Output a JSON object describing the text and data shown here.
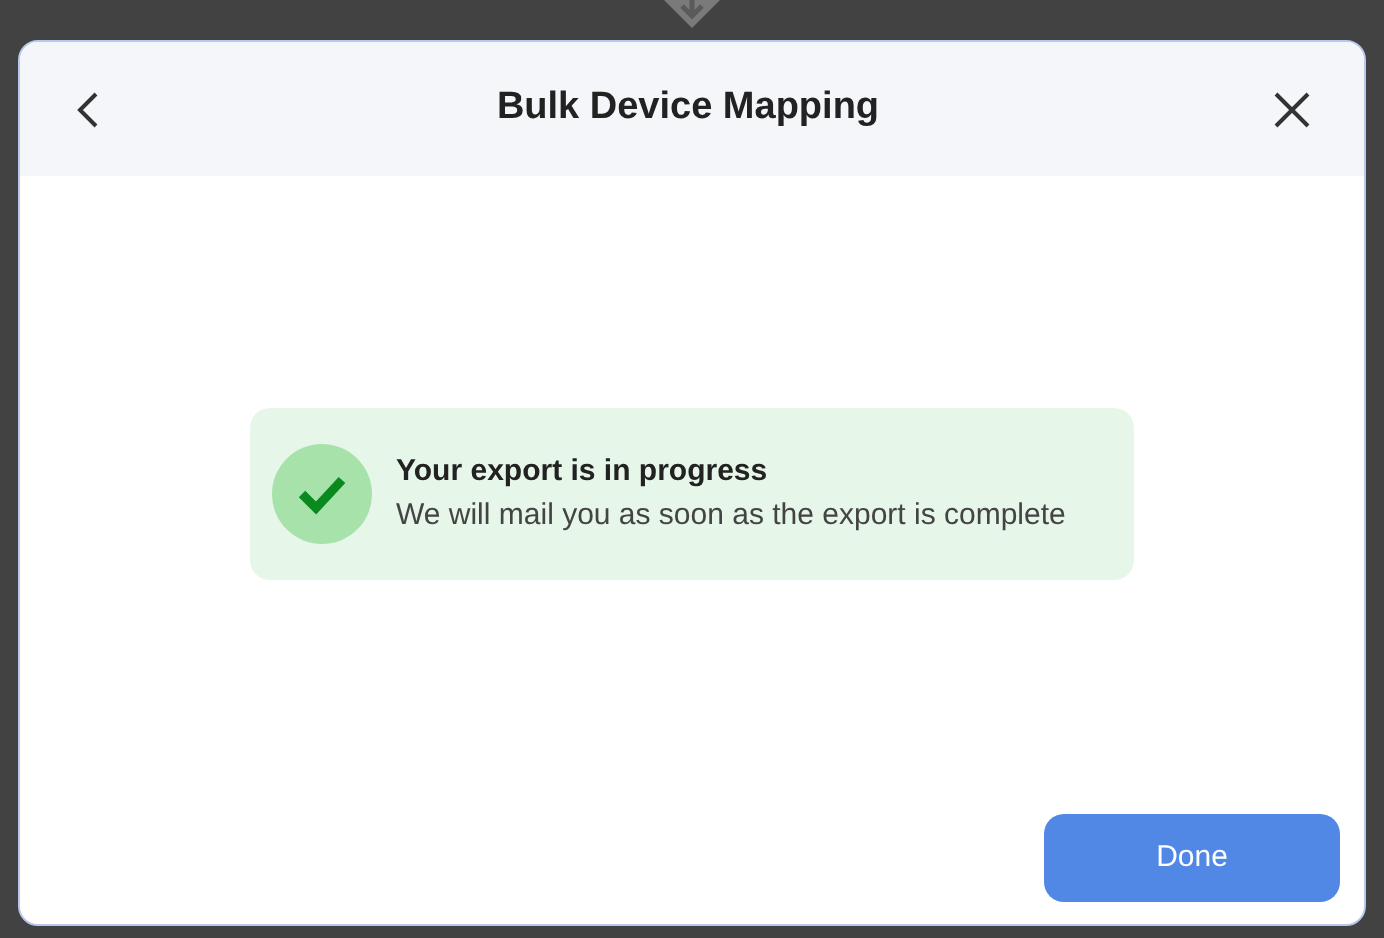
{
  "dialog": {
    "title": "Bulk Device Mapping"
  },
  "alert": {
    "kind": "success",
    "title": "Your export is in progress",
    "message": "We will mail you as soon as the export is complete"
  },
  "buttons": [
    {
      "label": "Done"
    }
  ]
}
